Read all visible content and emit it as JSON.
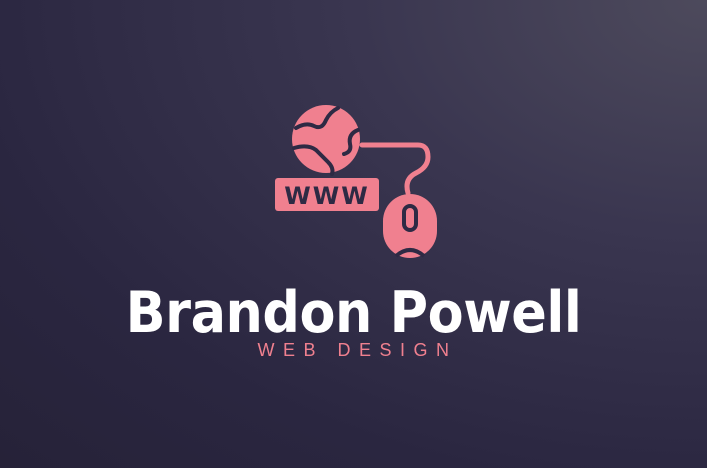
{
  "brand": {
    "name": "Brandon Powell",
    "tagline": "WEB DESIGN",
    "icon_text": "WWW",
    "icon": "globe-www-mouse-icon",
    "colors": {
      "accent": "#f0808f",
      "background": "#2a2640",
      "text": "#ffffff"
    }
  }
}
